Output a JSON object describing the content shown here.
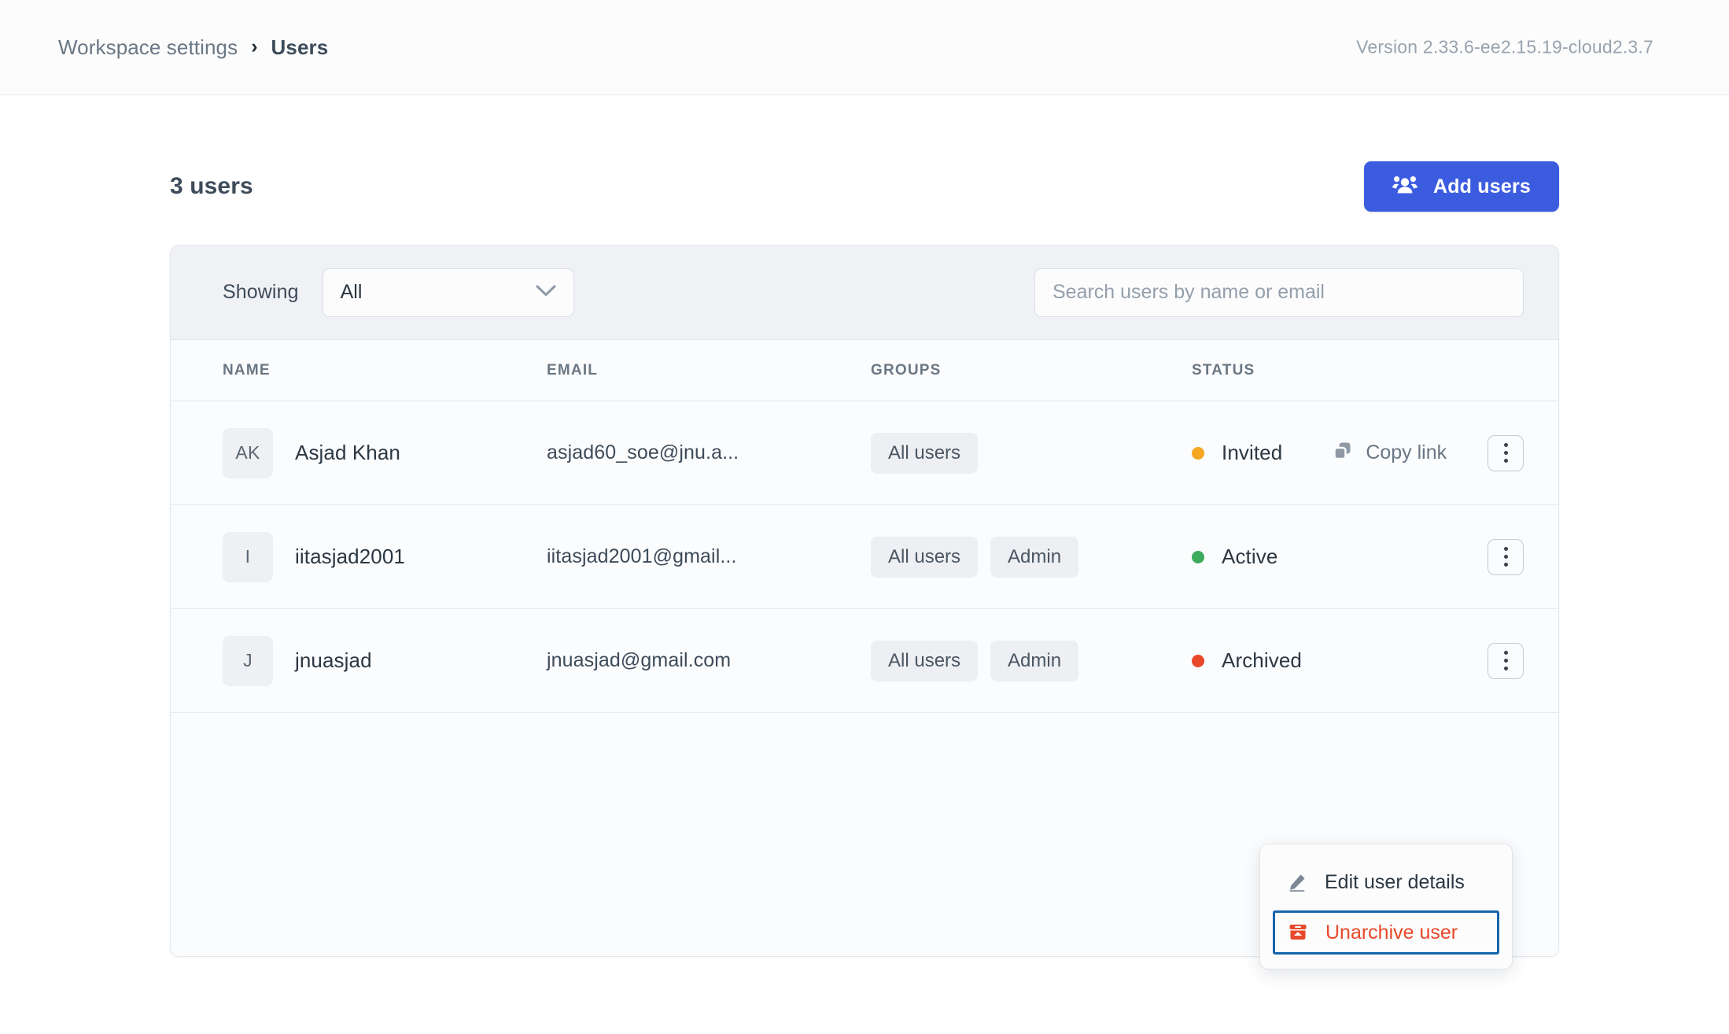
{
  "topbar": {
    "breadcrumb_parent": "Workspace settings",
    "breadcrumb_separator": "›",
    "breadcrumb_current": "Users",
    "version": "Version 2.33.6-ee2.15.19-cloud2.3.7"
  },
  "header": {
    "users_count": "3 users",
    "add_users_label": "Add users",
    "add_users_icon": "people-group-icon",
    "accent_color": "#3c5ce0"
  },
  "filters": {
    "showing_label": "Showing",
    "select_value": "All",
    "select_options": [
      "All"
    ],
    "select_icon": "chevron-down-icon",
    "search_placeholder": "Search users by name or email",
    "search_value": ""
  },
  "table": {
    "columns": [
      "NAME",
      "EMAIL",
      "GROUPS",
      "STATUS"
    ],
    "rows": [
      {
        "initials": "AK",
        "name": "Asjad Khan",
        "email": "asjad60_soe@jnu.a...",
        "groups": [
          "All users"
        ],
        "status": "Invited",
        "status_color": "#f5a623",
        "action_label": "Copy link",
        "action_icon": "copy-icon",
        "menu_icon": "kebab-menu-icon"
      },
      {
        "initials": "I",
        "name": "iitasjad2001",
        "email": "iitasjad2001@gmail...",
        "groups": [
          "All users",
          "Admin"
        ],
        "status": "Active",
        "status_color": "#3dab5e",
        "action_label": "",
        "action_icon": "",
        "menu_icon": "kebab-menu-icon"
      },
      {
        "initials": "J",
        "name": "jnuasjad",
        "email": "jnuasjad@gmail.com",
        "groups": [
          "All users",
          "Admin"
        ],
        "status": "Archived",
        "status_color": "#e8492a",
        "action_label": "",
        "action_icon": "",
        "menu_icon": "kebab-menu-icon"
      }
    ]
  },
  "context_menu": {
    "items": [
      {
        "label": "Edit user details",
        "icon": "pencil-icon",
        "danger": false,
        "focused": false
      },
      {
        "label": "Unarchive user",
        "icon": "unarchive-icon",
        "danger": true,
        "focused": true
      }
    ],
    "focus_ring_color": "#1565ad",
    "danger_color": "#e8492a"
  }
}
